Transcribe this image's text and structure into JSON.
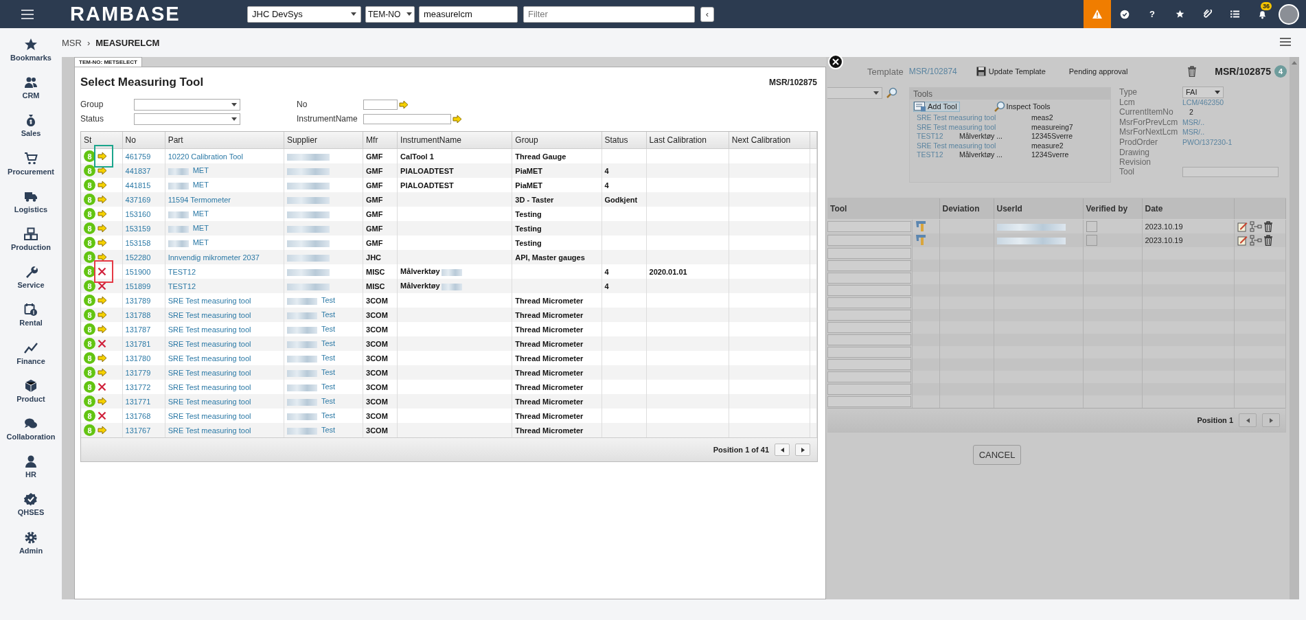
{
  "topbar": {
    "logo": "RAMBASE",
    "company": "JHC DevSys",
    "context": "TEM-NO",
    "search": "measurelcm",
    "filter_placeholder": "Filter",
    "collapse": "‹",
    "help": "?",
    "notifications": "36"
  },
  "sidebar": {
    "items": [
      {
        "label": "Bookmarks"
      },
      {
        "label": "CRM"
      },
      {
        "label": "Sales"
      },
      {
        "label": "Procurement"
      },
      {
        "label": "Logistics"
      },
      {
        "label": "Production"
      },
      {
        "label": "Service"
      },
      {
        "label": "Rental"
      },
      {
        "label": "Finance"
      },
      {
        "label": "Product"
      },
      {
        "label": "Collaboration"
      },
      {
        "label": "HR"
      },
      {
        "label": "QHSES"
      },
      {
        "label": "Admin"
      }
    ]
  },
  "breadcrumb": {
    "parent": "MSR",
    "separator": "›",
    "current": "MEASURELCM"
  },
  "dialog": {
    "tab": "TEM-NO: METSELECT",
    "title": "Select Measuring Tool",
    "ref": "MSR/102875",
    "filters": [
      {
        "label": "Group",
        "kind": "select"
      },
      {
        "label": "No",
        "kind": "input"
      },
      {
        "label": "Status",
        "kind": "select"
      },
      {
        "label": "InstrumentName",
        "kind": "input"
      }
    ],
    "table": {
      "columns": [
        "St",
        "No",
        "Part",
        "Supplier",
        "Mfr",
        "InstrumentName",
        "Group",
        "Status",
        "Last Calibration",
        "Next Calibration"
      ],
      "rows": [
        {
          "st": "8",
          "kind": "arrow",
          "color": "#1aa58c",
          "no": "461759",
          "part": "10220 Calibration Tool",
          "part_redacted": false,
          "mfr": "GMF",
          "instrument": "CalTool 1",
          "instrument_redacted": false,
          "group": "Thread Gauge"
        },
        {
          "st": "8",
          "kind": "arrow",
          "no": "441837",
          "part": "MET",
          "part_redacted": true,
          "mfr": "GMF",
          "instrument": "PIALOADTEST",
          "instrument_redacted": false,
          "group": "PiaMET",
          "status": "4"
        },
        {
          "st": "8",
          "kind": "arrow",
          "no": "441815",
          "part": "MET",
          "part_redacted": true,
          "mfr": "GMF",
          "instrument": "PIALOADTEST",
          "instrument_redacted": false,
          "group": "PiaMET",
          "status": "4"
        },
        {
          "st": "8",
          "kind": "arrow",
          "no": "437169",
          "part": "11594 Termometer",
          "part_redacted": false,
          "mfr": "GMF",
          "instrument_redacted": false,
          "group": "3D - Taster",
          "status": "Godkjent"
        },
        {
          "st": "8",
          "kind": "arrow",
          "no": "153160",
          "part": "MET",
          "part_redacted": true,
          "mfr": "GMF",
          "instrument_redacted": false,
          "group": "Testing"
        },
        {
          "st": "8",
          "kind": "arrow",
          "no": "153159",
          "part": "MET",
          "part_redacted": true,
          "mfr": "GMF",
          "instrument_redacted": false,
          "group": "Testing"
        },
        {
          "st": "8",
          "kind": "arrow",
          "no": "153158",
          "part": "MET",
          "part_redacted": true,
          "mfr": "GMF",
          "instrument_redacted": false,
          "group": "Testing"
        },
        {
          "st": "8",
          "kind": "arrow",
          "no": "152280",
          "part": "Innvendig mikrometer 2037",
          "part_redacted": false,
          "mfr": "JHC",
          "instrument_redacted": false,
          "group": "API, Master gauges"
        },
        {
          "st": "8",
          "kind": "cross",
          "color": "#e53945",
          "no": "151900",
          "part": "TEST12",
          "part_redacted": false,
          "mfr": "MISC",
          "instrument": "Målverktøy",
          "instrument_redacted": true,
          "status": "4",
          "last_calibration": "2020.01.01"
        },
        {
          "st": "8",
          "kind": "cross",
          "no": "151899",
          "part": "TEST12",
          "part_redacted": false,
          "mfr": "MISC",
          "instrument": "Målverktøy",
          "instrument_redacted": true,
          "status": "4"
        },
        {
          "st": "8",
          "kind": "arrow",
          "no": "131789",
          "part": "SRE Test measuring tool",
          "part_redacted": false,
          "supplier": "Test",
          "mfr": "3COM",
          "instrument_redacted": false,
          "group": "Thread Micrometer"
        },
        {
          "st": "8",
          "kind": "arrow",
          "no": "131788",
          "part": "SRE Test measuring tool",
          "part_redacted": false,
          "supplier": "Test",
          "mfr": "3COM",
          "instrument_redacted": false,
          "group": "Thread Micrometer"
        },
        {
          "st": "8",
          "kind": "arrow",
          "no": "131787",
          "part": "SRE Test measuring tool",
          "part_redacted": false,
          "supplier": "Test",
          "mfr": "3COM",
          "instrument_redacted": false,
          "group": "Thread Micrometer"
        },
        {
          "st": "8",
          "kind": "cross",
          "no": "131781",
          "part": "SRE Test measuring tool",
          "part_redacted": false,
          "supplier": "Test",
          "mfr": "3COM",
          "instrument_redacted": false,
          "group": "Thread Micrometer"
        },
        {
          "st": "8",
          "kind": "arrow",
          "no": "131780",
          "part": "SRE Test measuring tool",
          "part_redacted": false,
          "supplier": "Test",
          "mfr": "3COM",
          "instrument_redacted": false,
          "group": "Thread Micrometer"
        },
        {
          "st": "8",
          "kind": "arrow",
          "no": "131779",
          "part": "SRE Test measuring tool",
          "part_redacted": false,
          "supplier": "Test",
          "mfr": "3COM",
          "instrument_redacted": false,
          "group": "Thread Micrometer"
        },
        {
          "st": "8",
          "kind": "cross",
          "no": "131772",
          "part": "SRE Test measuring tool",
          "part_redacted": false,
          "supplier": "Test",
          "mfr": "3COM",
          "instrument_redacted": false,
          "group": "Thread Micrometer"
        },
        {
          "st": "8",
          "kind": "arrow",
          "no": "131771",
          "part": "SRE Test measuring tool",
          "part_redacted": false,
          "supplier": "Test",
          "mfr": "3COM",
          "instrument_redacted": false,
          "group": "Thread Micrometer"
        },
        {
          "st": "8",
          "kind": "cross",
          "no": "131768",
          "part": "SRE Test measuring tool",
          "part_redacted": false,
          "supplier": "Test",
          "mfr": "3COM",
          "instrument_redacted": false,
          "group": "Thread Micrometer"
        },
        {
          "st": "8",
          "kind": "arrow",
          "no": "131767",
          "part": "SRE Test measuring tool",
          "part_redacted": false,
          "supplier": "Test",
          "mfr": "3COM",
          "instrument_redacted": false,
          "group": "Thread Micrometer"
        }
      ]
    },
    "pager": "Position 1 of 41"
  },
  "record": {
    "template_label": "Template",
    "template": "MSR/102874",
    "update": "Update Template",
    "state": "Pending approval",
    "ref": "MSR/102875",
    "badge": "4",
    "tools": {
      "title": "Tools",
      "add": "Add Tool",
      "inspect": "Inspect Tools",
      "items": [
        {
          "name": "SRE Test measuring tool",
          "value": "meas2"
        },
        {
          "name": "SRE Test measuring tool",
          "value": "measureing7"
        },
        {
          "name": "TEST12",
          "instrument": "Målverktøy ...",
          "value": "12345Sverre"
        },
        {
          "name": "SRE Test measuring tool",
          "value": "measure2"
        },
        {
          "name": "TEST12",
          "instrument": "Målverktøy ...",
          "value": "1234Sverre"
        }
      ]
    },
    "props": [
      {
        "label": "Type",
        "value": "FAI",
        "kind": "select"
      },
      {
        "label": "Lcm",
        "value": "LCM/462350",
        "kind": "link"
      },
      {
        "label": "CurrentItemNo",
        "value": "2",
        "kind": "text"
      },
      {
        "label": "MsrForPrevLcm",
        "value": "MSR/..",
        "kind": "link"
      },
      {
        "label": "MsrForNextLcm",
        "value": "MSR/..",
        "kind": "link"
      },
      {
        "label": "ProdOrder",
        "value": "PWO/137230-1",
        "kind": "link"
      },
      {
        "label": "Drawing Revision",
        "kind": "text"
      },
      {
        "label": "Tool",
        "kind": "input"
      }
    ],
    "lines": {
      "columns": [
        "Tool",
        "Deviation",
        "UserId",
        "Verified by",
        "Date"
      ],
      "rows": [
        {
          "kind": "entry",
          "verified": false,
          "date": "2023.10.19"
        },
        {
          "kind": "entry",
          "verified": false,
          "date": "2023.10.19"
        },
        {
          "kind": "blank"
        },
        {
          "kind": "blank"
        },
        {
          "kind": "blank"
        },
        {
          "kind": "blank"
        },
        {
          "kind": "blank"
        },
        {
          "kind": "blank"
        },
        {
          "kind": "blank"
        },
        {
          "kind": "blank"
        },
        {
          "kind": "blank"
        },
        {
          "kind": "blank"
        },
        {
          "kind": "blank"
        },
        {
          "kind": "blank"
        },
        {
          "kind": "blank"
        }
      ]
    },
    "pager": "Position 1",
    "cancel": "CANCEL"
  }
}
